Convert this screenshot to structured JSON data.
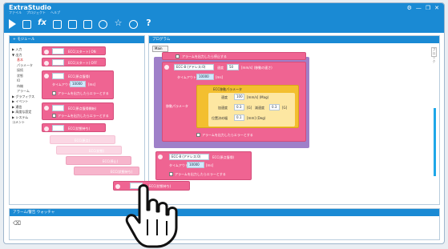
{
  "app": {
    "title": "ExtraStudio",
    "menu": [
      "ファイル",
      "プロジェクト",
      "ヘルプ"
    ],
    "window_controls": [
      "⚙",
      "—",
      "❐",
      "✕"
    ]
  },
  "toolbar": {
    "icons": [
      "play-icon",
      "stop-icon",
      "function-icon",
      "save-icon",
      "table-icon",
      "list-icon",
      "timer-icon",
      "star-icon",
      "gear-icon",
      "help-icon"
    ],
    "fx_label": "fx",
    "help_label": "?"
  },
  "left_panel": {
    "header": "+ モジュール",
    "tree": [
      {
        "label": "▶ 入力",
        "level": 0
      },
      {
        "label": "▼ 出力",
        "level": 0
      },
      {
        "label": "基本",
        "level": 1,
        "active": true
      },
      {
        "label": "パラメータ",
        "level": 1
      },
      {
        "label": "接続",
        "level": 1
      },
      {
        "label": "状態",
        "level": 1
      },
      {
        "label": "IO",
        "level": 1
      },
      {
        "label": "待機",
        "level": 1
      },
      {
        "label": "アラーム",
        "level": 1
      },
      {
        "label": "▶ グラフィクス",
        "level": 0
      },
      {
        "label": "▶ イベント",
        "level": 0
      },
      {
        "label": "▶ 通信",
        "level": 0
      },
      {
        "label": "▶ 高度な設定",
        "level": 0
      },
      {
        "label": "▶ システム",
        "level": 0
      },
      {
        "label": "コメント",
        "level": 0
      }
    ],
    "blocks": [
      {
        "field": "ECC(スタート) ON"
      },
      {
        "field": "ECC(スタート) OFF"
      },
      {
        "field": "ECC(原点復帰)"
      },
      {
        "timeout_label": "タイムアウト",
        "timeout_value": "10000",
        "unit": "[ms]",
        "alarm_text": "アラームを出力したらエラーとする"
      },
      {
        "field": "ECC(原点復帰開始)"
      },
      {
        "alarm_text": "アラームを出力したらエラーとする"
      },
      {
        "field": "ECC(状態待ち)"
      }
    ],
    "drag_ghosts": [
      "ECC(原点)",
      "ECC(状態)",
      "ECC(停止)",
      "ECC(状態待ち)"
    ],
    "drag_block": "ECC(状態待ち)"
  },
  "main_panel": {
    "header": "プログラム",
    "tab_label": "Main",
    "side_label": "ブロック",
    "loop_block": {
      "header_text": "アラームを出力したら停止する",
      "axis_select": "ECC-8 (アドレス:0)",
      "speed_label": "速度",
      "speed_value": "50",
      "speed_unit": "[mm/s] (移動の速さ)",
      "timeout_label": "タイムアウト",
      "timeout_value": "10000",
      "timeout_unit": "[ms]",
      "move_label": "移動パラメータ",
      "yellow": {
        "title": "ECC移動パラメータ",
        "rows": [
          {
            "label": "速度",
            "value": "100",
            "unit": "[mm/s] (Mag)"
          },
          {
            "label": "加速度",
            "value": "0.3",
            "unit": "[G]",
            "label2": "減速度",
            "value2": "0.3",
            "unit2": "[G]"
          },
          {
            "label": "位置決め幅",
            "value": "0.1",
            "unit": "[mm] (Deg)"
          }
        ]
      },
      "alarm_text": "アラームを出力したらエラーとする"
    },
    "second_block": {
      "axis_select": "ECC-8 (アドレス:0)",
      "field": "ECC(原点復帰)",
      "timeout_label": "タイムアウト",
      "timeout_value": "10000",
      "timeout_unit": "[ms]",
      "alarm_text": "アラームを出力したらエラーとする"
    }
  },
  "log_panel": {
    "header": "アラーム/警告  ウォッチャ"
  },
  "colors": {
    "titlebar": "#1a8ad4",
    "block_pink": "#ef6492",
    "loop_purple": "#9f80c9",
    "param_yellow": "#f3bf2f",
    "scroll_cyan": "#1ea7e8"
  }
}
